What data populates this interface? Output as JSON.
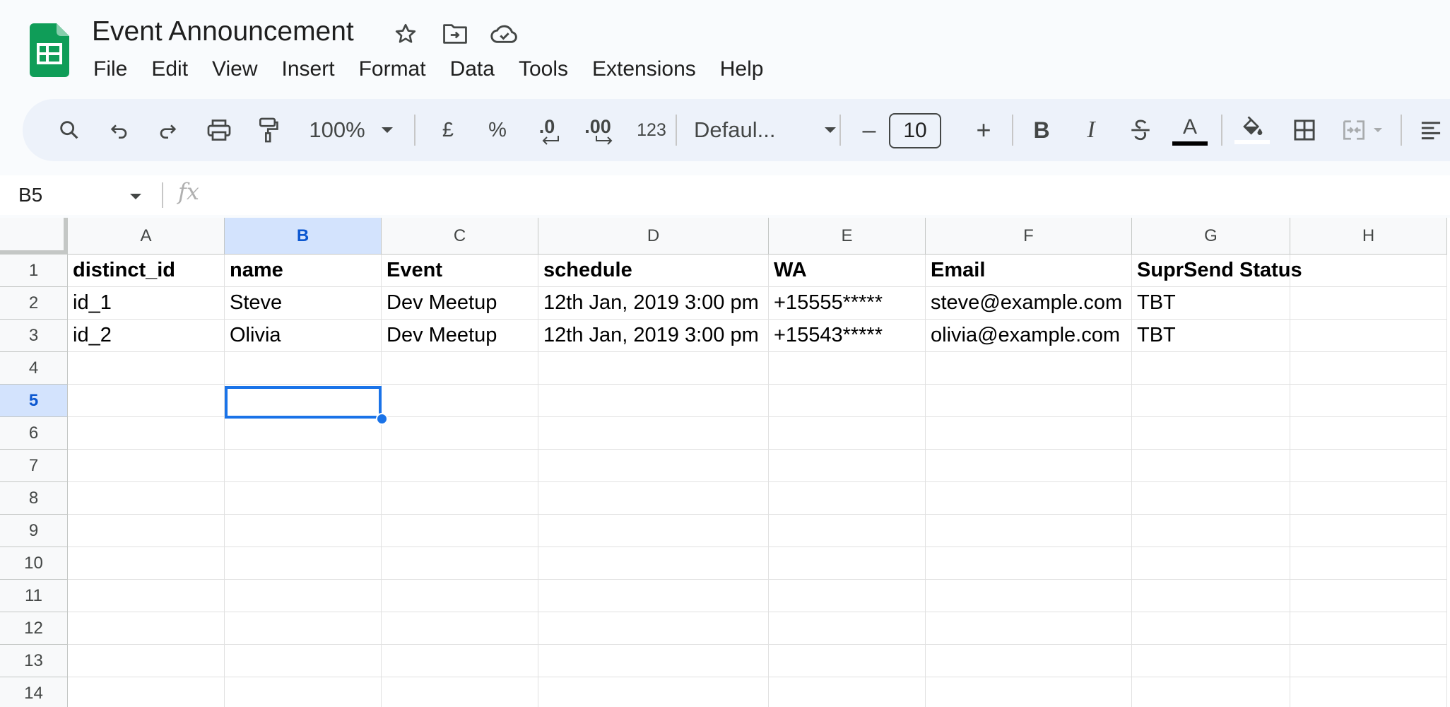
{
  "app": {
    "title": "Event Announcement",
    "icons": [
      "star-icon",
      "move-to-folder-icon",
      "cloud-saved-icon"
    ]
  },
  "menu": [
    "File",
    "Edit",
    "View",
    "Insert",
    "Format",
    "Data",
    "Tools",
    "Extensions",
    "Help"
  ],
  "toolbar": {
    "zoom": "100%",
    "currency": "£",
    "percent": "%",
    "decrease_decimal": ".0",
    "increase_decimal": ".00",
    "number_format": "123",
    "font": "Defaul...",
    "minus": "–",
    "font_size": "10",
    "plus": "+",
    "bold": "B",
    "italic": "I",
    "text_color_letter": "A",
    "text_color": "#000000"
  },
  "formula_bar": {
    "name_box": "B5",
    "fx": "fx",
    "value": ""
  },
  "sheet": {
    "columns": [
      "A",
      "B",
      "C",
      "D",
      "E",
      "F",
      "G",
      "H"
    ],
    "selected_column": "B",
    "rows": [
      "1",
      "2",
      "3",
      "4",
      "5",
      "6",
      "7",
      "8",
      "9",
      "10",
      "11",
      "12",
      "13",
      "14"
    ],
    "selected_row": "5",
    "selected_cell": "B5",
    "cells": [
      [
        "distinct_id",
        "name",
        "Event",
        "schedule",
        "WA",
        "Email",
        "SuprSend Status",
        ""
      ],
      [
        "id_1",
        "Steve",
        "Dev Meetup",
        "12th Jan, 2019 3:00 pm",
        "+15555*****",
        "steve@example.com",
        "TBT",
        ""
      ],
      [
        "id_2",
        "Olivia",
        "Dev Meetup",
        "12th Jan, 2019 3:00 pm",
        "+15543*****",
        "olivia@example.com",
        "TBT",
        ""
      ]
    ]
  },
  "colors": {
    "sheets_green": "#0f9d58",
    "selection_blue": "#1a73e8",
    "header_selected_bg": "#d3e3fd"
  }
}
